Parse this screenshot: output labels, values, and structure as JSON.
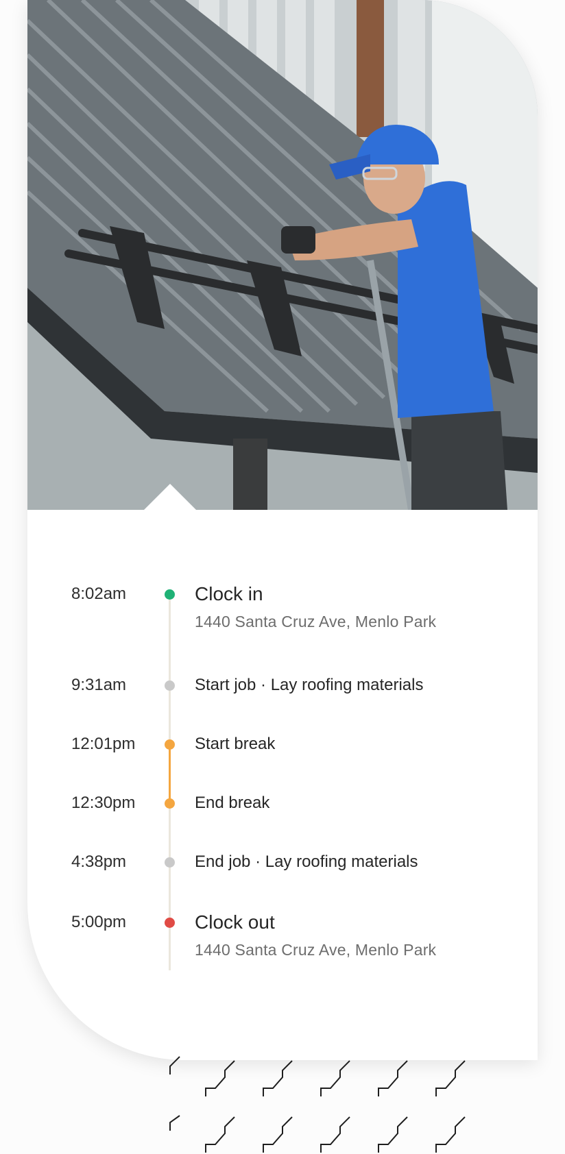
{
  "photo": {
    "description_icon": "roofer-photo"
  },
  "colors": {
    "clock_in": "#1fb276",
    "job": "#c9c9c9",
    "break": "#f4a640",
    "clock_out": "#e04b45",
    "track": "#ebe7dd"
  },
  "timeline": {
    "events": [
      {
        "time": "8:02am",
        "title": "Clock in",
        "address": "1440 Santa Cruz Ave, Menlo Park"
      },
      {
        "time": "9:31am",
        "title": "Start job · Lay roofing materials"
      },
      {
        "time": "12:01pm",
        "title": "Start break"
      },
      {
        "time": "12:30pm",
        "title": "End break"
      },
      {
        "time": "4:38pm",
        "title": "End job · Lay roofing materials"
      },
      {
        "time": "5:00pm",
        "title": "Clock out",
        "address": "1440 Santa Cruz Ave, Menlo Park"
      }
    ]
  }
}
